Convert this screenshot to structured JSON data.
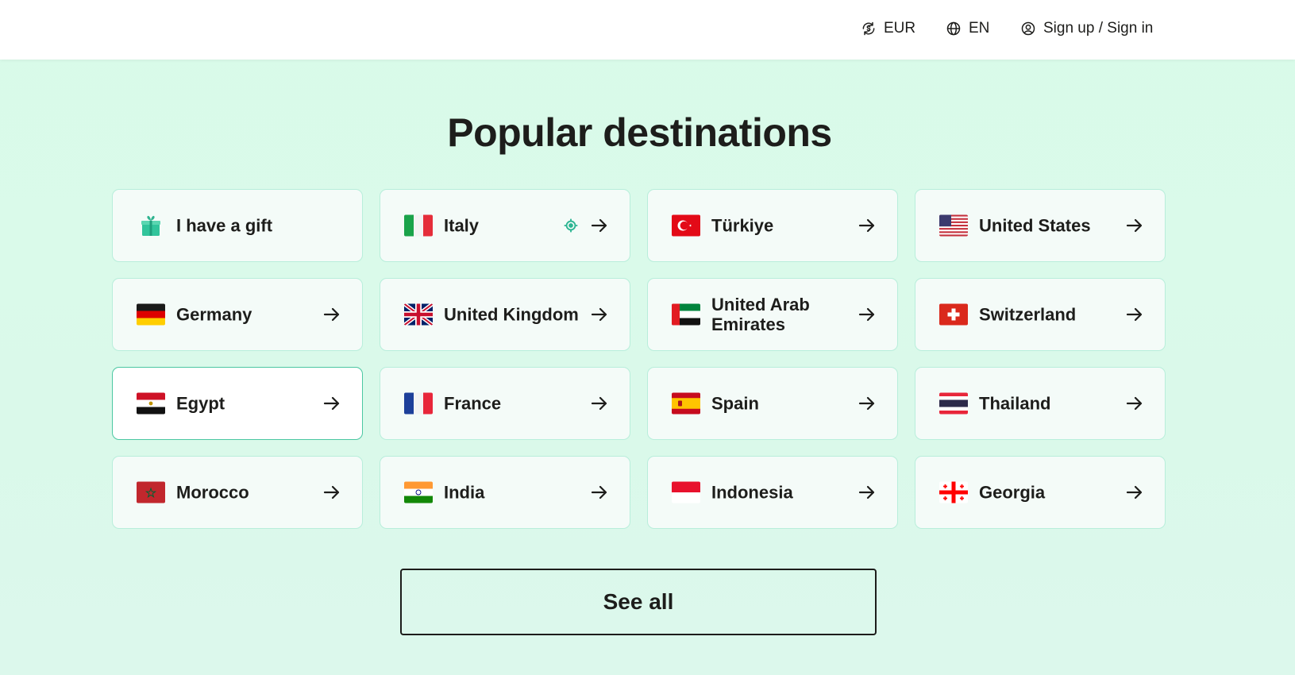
{
  "header": {
    "currency": "EUR",
    "language": "EN",
    "account": "Sign up / Sign in",
    "currency_icon": "currency-exchange-icon",
    "language_icon": "globe-icon",
    "account_icon": "user-circle-icon"
  },
  "main": {
    "title": "Popular destinations",
    "see_all": "See all",
    "accent_color": "#4bc7a2"
  },
  "destinations": [
    {
      "label": "I have a gift",
      "icon": "gift-icon"
    },
    {
      "label": "Italy",
      "icon": "italy-flag-icon",
      "extra_icon": "location-target-icon"
    },
    {
      "label": "Türkiye",
      "icon": "turkey-flag-icon"
    },
    {
      "label": "United States",
      "icon": "usa-flag-icon"
    },
    {
      "label": "Germany",
      "icon": "germany-flag-icon"
    },
    {
      "label": "United Kingdom",
      "icon": "uk-flag-icon"
    },
    {
      "label": "United Arab Emirates",
      "icon": "uae-flag-icon"
    },
    {
      "label": "Switzerland",
      "icon": "switzerland-flag-icon"
    },
    {
      "label": "Egypt",
      "icon": "egypt-flag-icon",
      "state": "hovered"
    },
    {
      "label": "France",
      "icon": "france-flag-icon"
    },
    {
      "label": "Spain",
      "icon": "spain-flag-icon"
    },
    {
      "label": "Thailand",
      "icon": "thailand-flag-icon"
    },
    {
      "label": "Morocco",
      "icon": "morocco-flag-icon"
    },
    {
      "label": "India",
      "icon": "india-flag-icon"
    },
    {
      "label": "Indonesia",
      "icon": "indonesia-flag-icon"
    },
    {
      "label": "Georgia",
      "icon": "georgia-flag-icon"
    }
  ]
}
